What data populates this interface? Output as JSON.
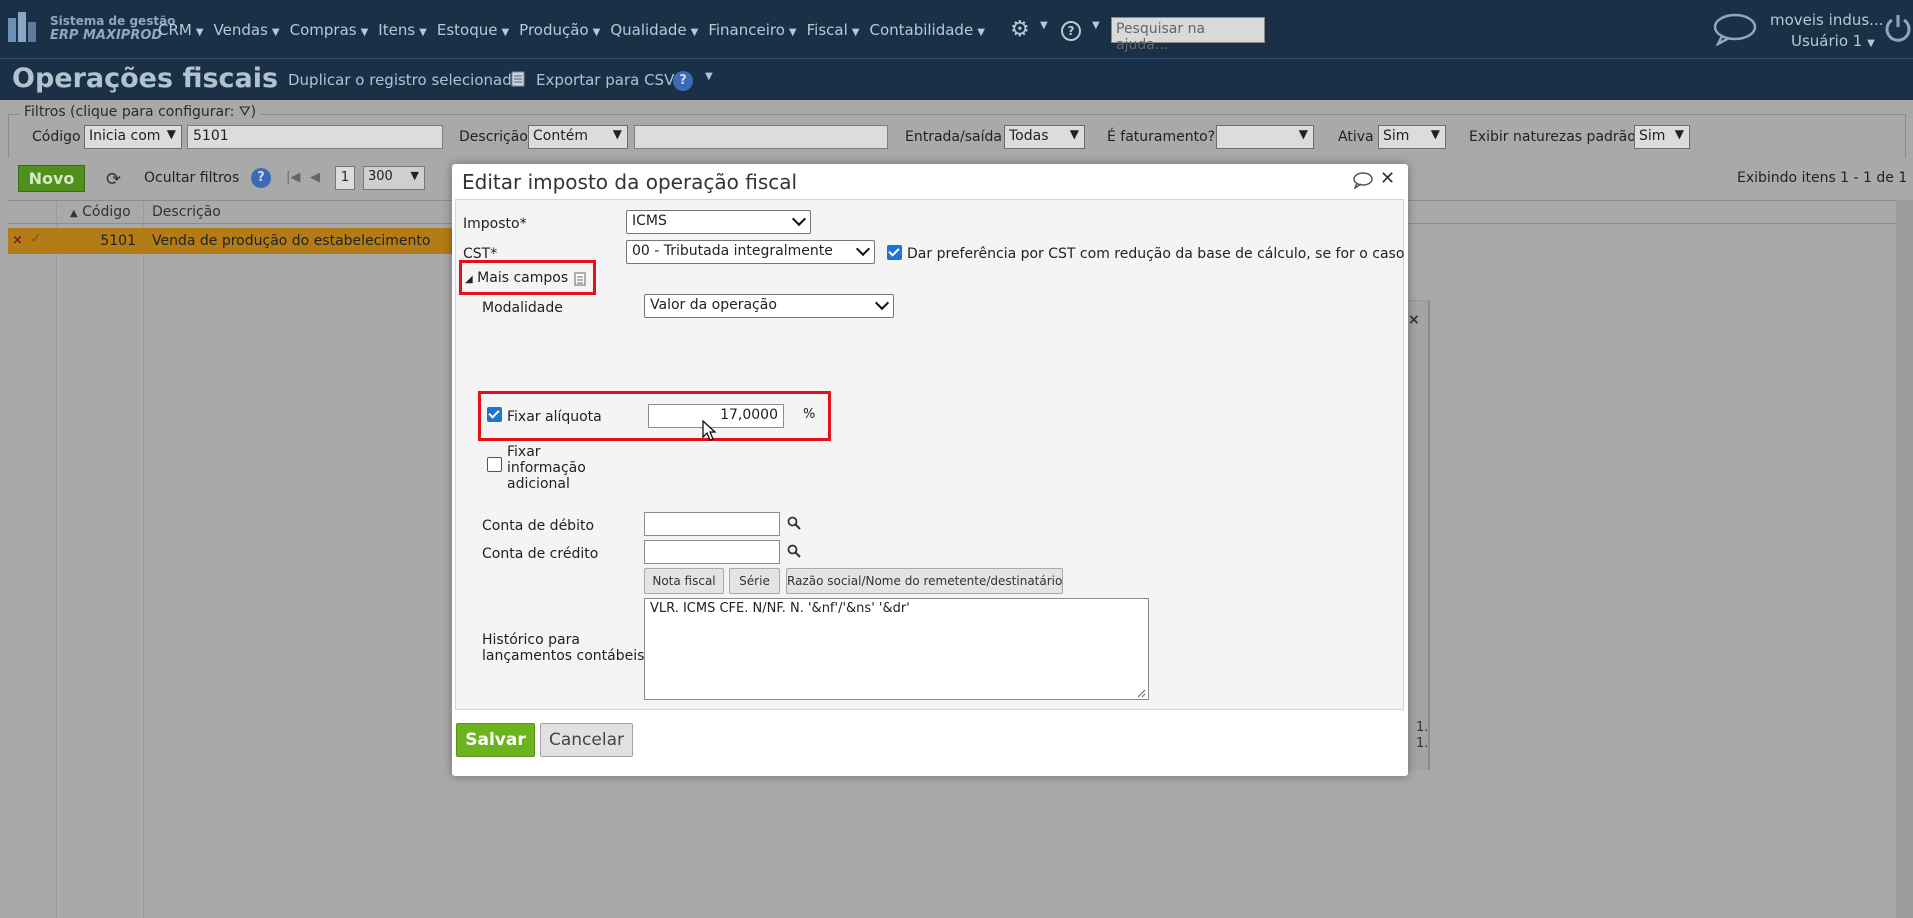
{
  "topbar": {
    "logo_line1": "Sistema de gestão",
    "logo_line2": "ERP MAXIPROD",
    "menu": [
      "CRM",
      "Vendas",
      "Compras",
      "Itens",
      "Estoque",
      "Produção",
      "Qualidade",
      "Financeiro",
      "Fiscal",
      "Contabilidade"
    ],
    "help_placeholder": "Pesquisar na ajuda...",
    "company": "moveis indus...",
    "user": "Usuário 1"
  },
  "header": {
    "title": "Operações fiscais",
    "duplicate": "Duplicar o registro selecionado",
    "export_csv": "Exportar para CSV"
  },
  "filters": {
    "legend": "Filtros (clique para configurar:",
    "legend_end": ")",
    "codigo_label": "Código",
    "codigo_op": "Inicia com",
    "codigo_value": "5101",
    "descricao_label": "Descrição",
    "descricao_op": "Contém",
    "descricao_value": "",
    "entrada_saida_label": "Entrada/saída",
    "entrada_saida_value": "Todas",
    "faturamento_label": "É faturamento?",
    "faturamento_value": "",
    "ativa_label": "Ativa",
    "ativa_value": "Sim",
    "naturezas_label": "Exibir naturezas padrão",
    "naturezas_value": "Sim"
  },
  "toolbar": {
    "novo": "Novo",
    "hide_filters": "Ocultar filtros",
    "page": "1",
    "page_size": "300",
    "showing": "Exibindo itens 1 - 1 de 1"
  },
  "grid": {
    "columns": [
      "Código",
      "Descrição"
    ],
    "rows": [
      {
        "codigo": "5101",
        "descricao": "Venda de produção do estabelecimento"
      }
    ]
  },
  "bg_dialog": {
    "line1": "1.",
    "line2": "1."
  },
  "modal": {
    "title": "Editar imposto da operação fiscal",
    "imposto_label": "Imposto*",
    "imposto_value": "ICMS",
    "cst_label": "CST*",
    "cst_value": "00 - Tributada integralmente",
    "prefer_cst_label": "Dar preferência por CST com redução da base de cálculo, se for o caso",
    "prefer_cst_checked": true,
    "mais_campos": "Mais campos",
    "modalidade_label": "Modalidade",
    "modalidade_value": "Valor da operação",
    "fixar_aliquota_label": "Fixar alíquota",
    "fixar_aliquota_checked": true,
    "aliquota_value": "17,0000",
    "aliquota_unit": "%",
    "fixar_info_line1": "Fixar",
    "fixar_info_line2": "informação",
    "fixar_info_line3": "adicional",
    "fixar_info_checked": false,
    "conta_debito_label": "Conta de débito",
    "conta_credito_label": "Conta de crédito",
    "conta_debito_value": "",
    "conta_credito_value": "",
    "btn_nota_fiscal": "Nota fiscal",
    "btn_serie": "Série",
    "btn_razao": "Razão social/Nome do remetente/destinatário",
    "historico_label1": "Histórico para",
    "historico_label2": "lançamentos contábeis",
    "historico_value": "VLR. ICMS CFE. N/NF. N. '&nf'/'&ns' '&dr'",
    "save": "Salvar",
    "cancel": "Cancelar"
  },
  "colors": {
    "topbar_bg": "#1a3047",
    "selected_row": "#b37c17",
    "novo_green": "#4f8f1b",
    "save_green": "#6db31f",
    "highlight_red": "#e3101a",
    "checkbox_blue": "#1f72d6"
  },
  "icons": [
    "logo-icon",
    "gear-icon",
    "help-icon",
    "chat-icon",
    "power-icon",
    "csv-icon",
    "filter-icon",
    "refresh-icon",
    "search-icon",
    "close-icon",
    "resize-grip-icon",
    "doc-icon",
    "cursor-icon"
  ]
}
